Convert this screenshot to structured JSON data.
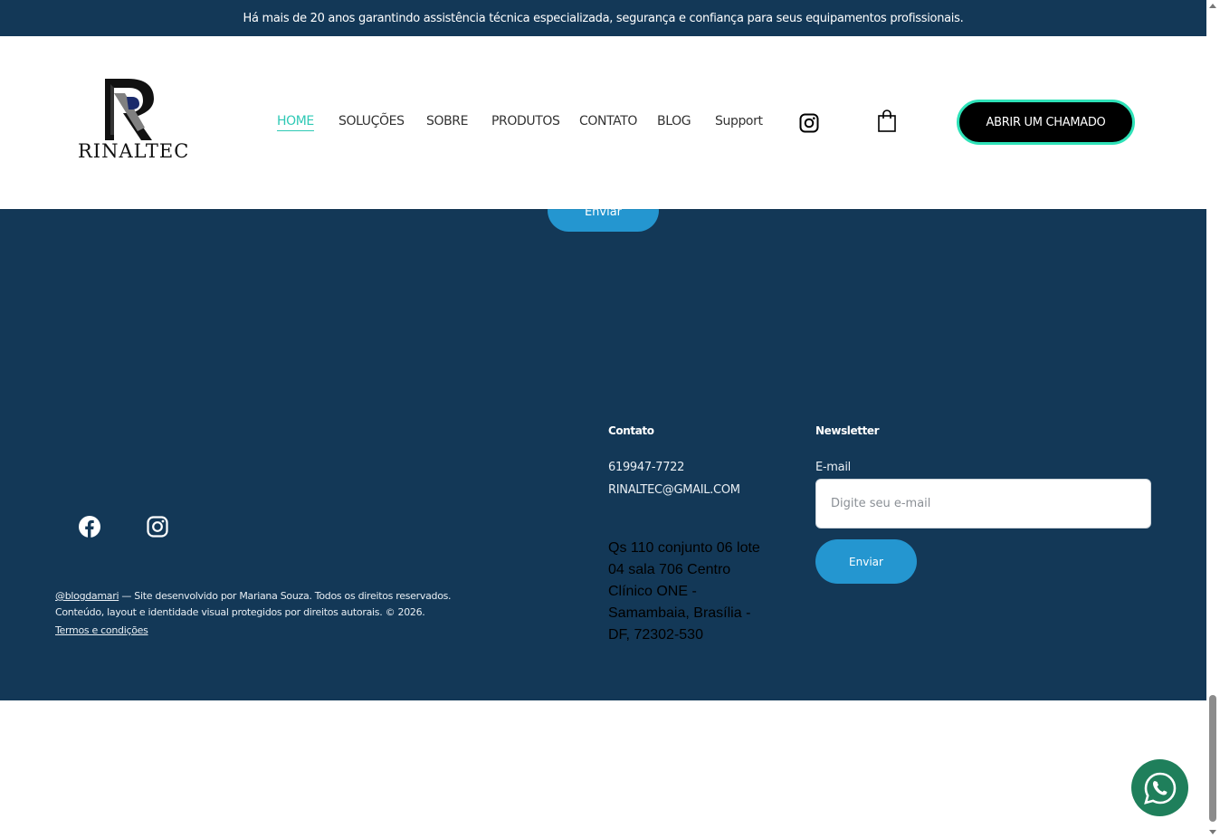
{
  "topbar": {
    "text": "Há mais de 20 anos garantindo assistência técnica especializada, segurança e confiança para seus equipamentos profissionais."
  },
  "header": {
    "logo_text": "RINALTEC",
    "nav": [
      {
        "label": "HOME",
        "active": true
      },
      {
        "label": "SOLUÇÕES",
        "active": false
      },
      {
        "label": "SOBRE",
        "active": false
      },
      {
        "label": "PRODUTOS",
        "active": false
      },
      {
        "label": "CONTATO",
        "active": false
      },
      {
        "label": "BLOG",
        "active": false
      },
      {
        "label": "Support",
        "active": false
      }
    ],
    "icons": {
      "social": "instagram-icon",
      "cart": "shopping-bag-icon"
    },
    "cta_label": "ABRIR UM CHAMADO"
  },
  "peek_button_label": "Enviar",
  "footer": {
    "social_icons": [
      "facebook-icon",
      "instagram-icon"
    ],
    "contact": {
      "title": "Contato",
      "phone": "619947-7722",
      "email": "RINALTEC@GMAIL.COM",
      "address": "Qs 110 conjunto 06 lote 04 sala 706 Centro Clínico ONE - Samambaia, Brasília - DF, 72302-530"
    },
    "newsletter": {
      "title": "Newsletter",
      "field_label": "E-mail",
      "placeholder": "Digite seu e-mail",
      "button_label": "Enviar"
    },
    "copyright": {
      "handle": "@blogdamari",
      "line1_rest": " — Site desenvolvido por Mariana Souza. Todos os direitos reservados.",
      "line2": "Conteúdo, layout e identidade visual protegidos por direitos autorais. © 2026.",
      "terms": "Termos e condições"
    }
  },
  "floating": {
    "whatsapp": "whatsapp-icon"
  },
  "colors": {
    "primary_dark": "#133857",
    "accent": "#2ec9b5",
    "button_blue": "#2496d0",
    "cta_border": "#2ee2b8",
    "whatsapp": "#1f7f5b"
  }
}
